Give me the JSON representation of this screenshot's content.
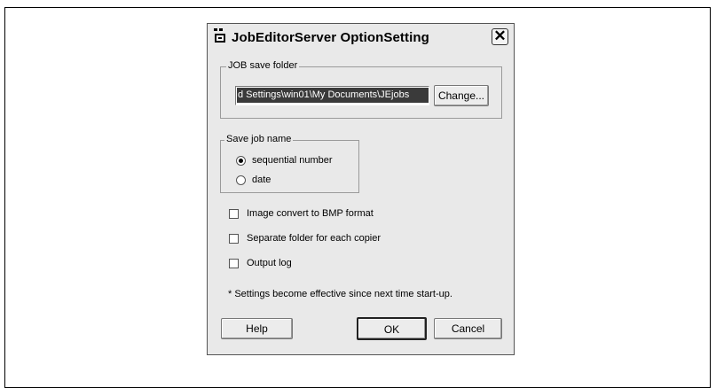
{
  "dialog": {
    "title": "JobEditorServer OptionSetting",
    "close_label": "✕"
  },
  "job_save_folder": {
    "legend": "JOB save folder",
    "path_value": "d Settings\\win01\\My Documents\\JEjobs",
    "change_button": "Change..."
  },
  "save_job_name": {
    "legend": "Save job name",
    "options": [
      {
        "label": "sequential number",
        "selected": true
      },
      {
        "label": "date",
        "selected": false
      }
    ]
  },
  "options": [
    {
      "label": "Image convert to BMP format",
      "checked": false
    },
    {
      "label": "Separate folder for each copier",
      "checked": false
    },
    {
      "label": "Output log",
      "checked": false
    }
  ],
  "note": "* Settings become effective since next time start-up.",
  "buttons": {
    "help": "Help",
    "ok": "OK",
    "cancel": "Cancel"
  }
}
